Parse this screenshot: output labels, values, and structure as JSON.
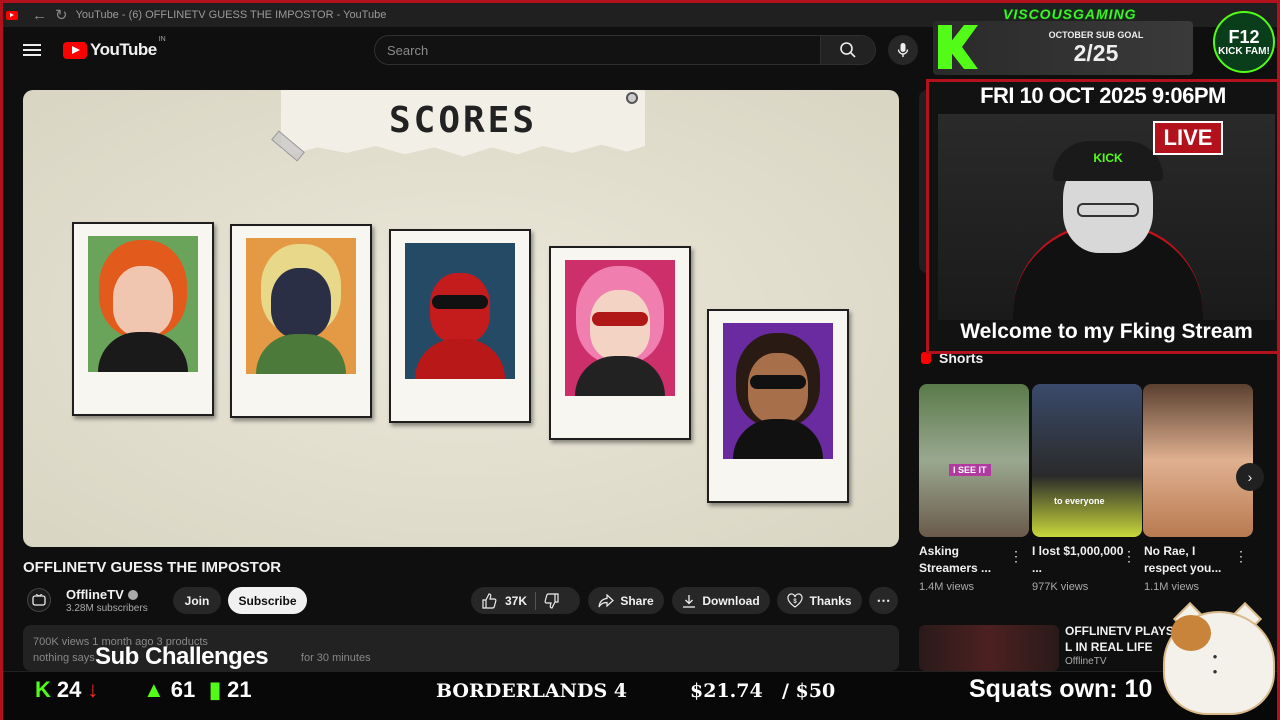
{
  "browser": {
    "tab_title": "YouTube - (6) OFFLINETV GUESS THE IMPOSTOR - YouTube"
  },
  "header": {
    "logo_text": "YouTube",
    "region": "IN",
    "search_placeholder": "Search"
  },
  "player": {
    "scene_title": "SCORES"
  },
  "video": {
    "title": "OFFLINETV GUESS THE IMPOSTOR",
    "channel": "OfflineTV",
    "subscribers": "3.28M subscribers",
    "join_label": "Join",
    "subscribe_label": "Subscribe",
    "likes": "37K",
    "share_label": "Share",
    "download_label": "Download",
    "thanks_label": "Thanks",
    "description_meta": "700K views  1 month ago  3 products",
    "description_line_start": "nothing says",
    "description_line_end": "for 30 minutes"
  },
  "sidebar": {
    "shorts_heading": "Shorts",
    "shorts": [
      {
        "title": "Asking Streamers ...",
        "views": "1.4M views",
        "overlay": "I SEE IT"
      },
      {
        "title": "I lost $1,000,000 ...",
        "views": "977K views",
        "overlay": "to everyone"
      },
      {
        "title": "No Rae, I respect you...",
        "views": "1.1M views",
        "overlay": ""
      }
    ],
    "recommended": {
      "title": "OFFLINETV PLAYS L IN REAL LIFE",
      "channel": "OfflineTV"
    }
  },
  "overlay": {
    "brand": "VISCOUSGAMING",
    "sub_goal_label": "OCTOBER SUB GOAL",
    "sub_goal_value": "2/25",
    "badge_line1": "F12",
    "badge_line2": "KICK FAM!",
    "datetime": "FRI 10 OCT 2025 9:06PM",
    "live_label": "LIVE",
    "cap_text": "KICK",
    "caption": "Welcome to my Fking Stream",
    "sub_challenges": "Sub Challenges",
    "stat_kick": "24",
    "stat_up": "61",
    "stat_bars": "21",
    "game": "BORDERLANDS 4",
    "money_raised": "$21.74",
    "money_goal": "/ $50",
    "squats": "Squats own: 10"
  },
  "colors": {
    "kick_green": "#53fc18",
    "youtube_red": "#ff0000",
    "frame_red": "#b3121c"
  }
}
